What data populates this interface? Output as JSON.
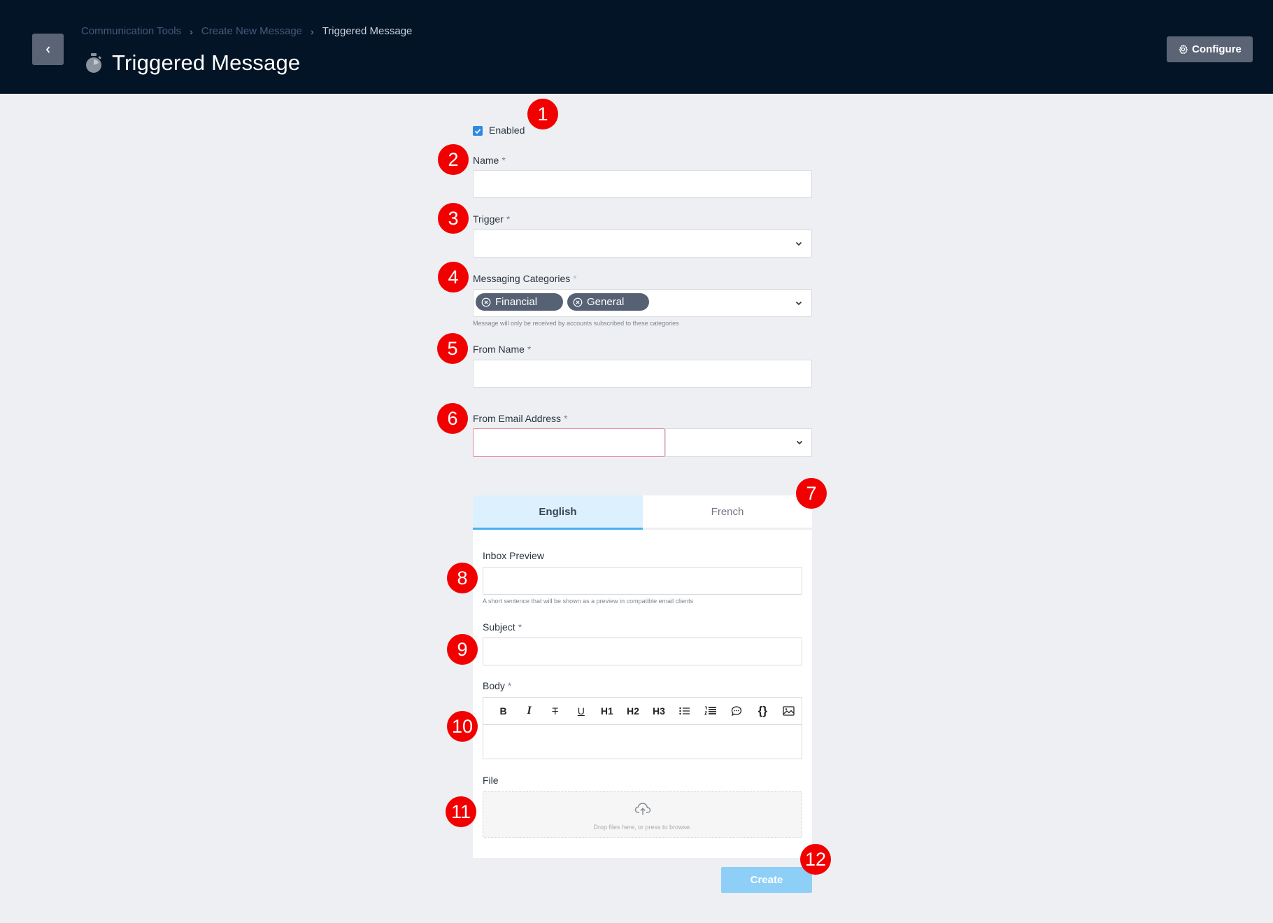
{
  "header": {
    "breadcrumb": [
      "Communication Tools",
      "Create New Message",
      "Triggered Message"
    ],
    "title": "Triggered Message",
    "configure_label": "Configure"
  },
  "form": {
    "enabled_label": "Enabled",
    "enabled_checked": true,
    "name_label": "Name",
    "name_value": "",
    "trigger_label": "Trigger",
    "trigger_value": "",
    "categories_label": "Messaging Categories",
    "categories": [
      "Financial",
      "General"
    ],
    "categories_hint": "Message will only be received by accounts subscribed to these categories",
    "from_name_label": "From Name",
    "from_name_value": "",
    "from_email_label": "From Email Address",
    "from_email_value": "",
    "from_email_domain": "",
    "required_mark": "*"
  },
  "tabs": [
    "English",
    "French"
  ],
  "english": {
    "inbox_preview_label": "Inbox Preview",
    "inbox_preview_hint": "A short sentence that will be shown as a preview in compatible email clients",
    "subject_label": "Subject",
    "body_label": "Body",
    "toolbar": [
      "B",
      "I",
      "T",
      "U",
      "H1",
      "H2",
      "H3",
      "bullet-list-icon",
      "numbered-list-icon",
      "comment-icon",
      "{}",
      "image-icon"
    ],
    "file_label": "File",
    "dropzone_text": "Drop files here, or press to browse."
  },
  "create_label": "Create",
  "markers": [
    "1",
    "2",
    "3",
    "4",
    "5",
    "6",
    "7",
    "8",
    "9",
    "10",
    "11",
    "12"
  ],
  "colors": {
    "header_bg": "#031426",
    "accent": "#49b1ee",
    "marker": "#f20000",
    "create_button": "#8ecff8",
    "chip": "#566173"
  }
}
